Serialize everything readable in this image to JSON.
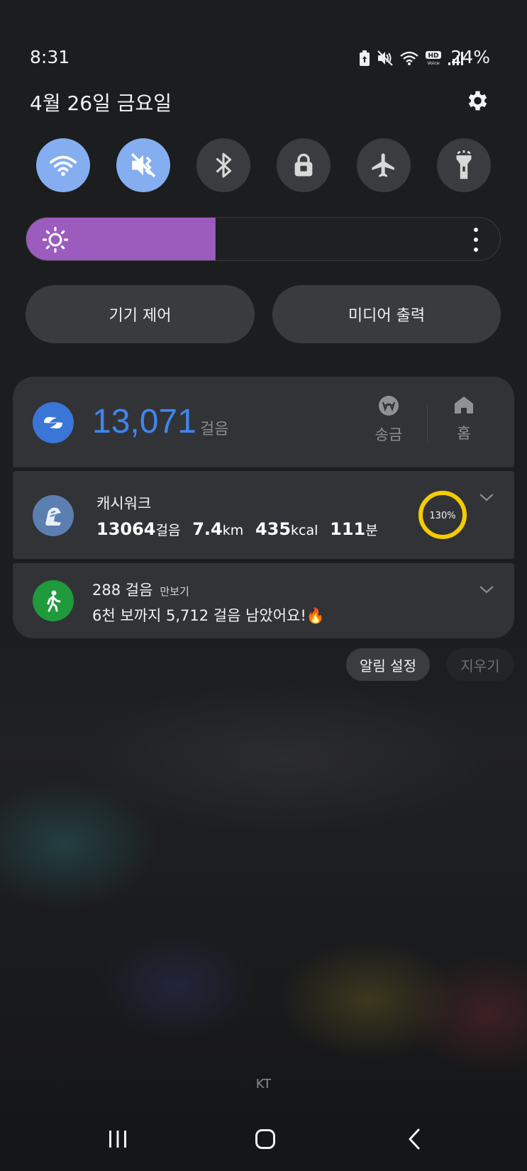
{
  "status_bar": {
    "time": "8:31",
    "battery": "24%",
    "icons": [
      "battery-saver-icon",
      "mute-icon",
      "wifi-icon",
      "hd-voice-icon",
      "signal-icon"
    ]
  },
  "header": {
    "date": "4월 26일 금요일",
    "settings_icon": "gear-icon"
  },
  "quick_toggles": [
    {
      "name": "wifi",
      "icon": "wifi-icon",
      "active": true
    },
    {
      "name": "sound",
      "icon": "mute-icon",
      "active": true
    },
    {
      "name": "bluetooth",
      "icon": "bluetooth-icon",
      "active": false
    },
    {
      "name": "rotation-lock",
      "icon": "lock-icon",
      "active": false
    },
    {
      "name": "airplane",
      "icon": "airplane-icon",
      "active": false
    },
    {
      "name": "flashlight",
      "icon": "flashlight-icon",
      "active": false
    }
  ],
  "brightness": {
    "level": 0.4,
    "color": "#9c5cbd"
  },
  "controls": {
    "device_control": "기기 제어",
    "media_output": "미디어 출력"
  },
  "notifications": {
    "toss": {
      "steps": "13,071",
      "unit": "걸음",
      "actions": [
        {
          "label": "송금",
          "icon": "won-transfer-icon"
        },
        {
          "label": "홈",
          "icon": "home-icon"
        }
      ],
      "accent": "#3f86ef"
    },
    "cashwalk": {
      "title": "캐시워크",
      "steps_value": "13064",
      "steps_unit": "걸음",
      "distance_value": "7.4",
      "distance_unit": "km",
      "calories_value": "435",
      "calories_unit": "kcal",
      "minutes_value": "111",
      "minutes_unit": "분",
      "progress_label": "130%",
      "progress": 1.0,
      "ring_color": "#f5cc00"
    },
    "pedometer": {
      "title": "288 걸음",
      "app": "만보기",
      "message": "6천 보까지 5,712 걸음 남았어요!🔥"
    }
  },
  "notification_actions": {
    "settings": "알림 설정",
    "clear": "지우기"
  },
  "carrier": "KT",
  "nav": {
    "recents_icon": "recents-icon",
    "home_icon": "home-button-icon",
    "back_icon": "back-icon"
  }
}
